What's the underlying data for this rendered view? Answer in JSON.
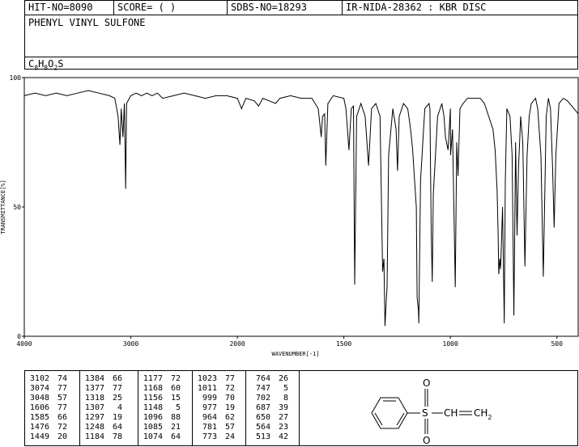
{
  "header": {
    "hit_no": "HIT-NO=8090",
    "score": "SCORE=  (   )",
    "sdbs_no": "SDBS-NO=18293",
    "source": "IR-NIDA-28362 : KBR DISC",
    "compound_name": "PHENYL VINYL SULFONE",
    "formula": {
      "c": "C",
      "c_n": "8",
      "h": "H",
      "h_n": "8",
      "o": "O",
      "o_n": "2",
      "s": "S"
    }
  },
  "chart_data": {
    "type": "line",
    "xlabel": "WAVENUMBER[-1]",
    "ylabel": "TRANSMITTANCE[%]",
    "xlim": [
      4000,
      400
    ],
    "ylim": [
      0,
      100
    ],
    "x_reversed": true,
    "xticks": [
      "4000",
      "3000",
      "2000",
      "1500",
      "1000",
      "500"
    ],
    "yticks": [
      "100",
      "50",
      "0"
    ],
    "grid": false,
    "series": [
      {
        "color": "#000000",
        "points": [
          [
            4000,
            93
          ],
          [
            3900,
            94
          ],
          [
            3800,
            93
          ],
          [
            3700,
            94
          ],
          [
            3600,
            93
          ],
          [
            3500,
            94
          ],
          [
            3400,
            95
          ],
          [
            3300,
            94
          ],
          [
            3200,
            93
          ],
          [
            3150,
            92
          ],
          [
            3120,
            85
          ],
          [
            3102,
            74
          ],
          [
            3090,
            88
          ],
          [
            3074,
            77
          ],
          [
            3060,
            90
          ],
          [
            3048,
            57
          ],
          [
            3040,
            90
          ],
          [
            3000,
            93
          ],
          [
            2950,
            94
          ],
          [
            2900,
            93
          ],
          [
            2850,
            94
          ],
          [
            2800,
            93
          ],
          [
            2750,
            94
          ],
          [
            2700,
            92
          ],
          [
            2600,
            93
          ],
          [
            2500,
            94
          ],
          [
            2400,
            93
          ],
          [
            2300,
            92
          ],
          [
            2200,
            93
          ],
          [
            2100,
            93
          ],
          [
            2000,
            92
          ],
          [
            1980,
            88
          ],
          [
            1960,
            92
          ],
          [
            1920,
            91
          ],
          [
            1900,
            89
          ],
          [
            1880,
            92
          ],
          [
            1850,
            91
          ],
          [
            1820,
            90
          ],
          [
            1800,
            92
          ],
          [
            1750,
            93
          ],
          [
            1700,
            92
          ],
          [
            1650,
            92
          ],
          [
            1620,
            88
          ],
          [
            1606,
            77
          ],
          [
            1600,
            85
          ],
          [
            1590,
            86
          ],
          [
            1585,
            66
          ],
          [
            1575,
            90
          ],
          [
            1550,
            93
          ],
          [
            1500,
            92
          ],
          [
            1490,
            88
          ],
          [
            1476,
            72
          ],
          [
            1465,
            88
          ],
          [
            1455,
            89
          ],
          [
            1449,
            20
          ],
          [
            1440,
            85
          ],
          [
            1420,
            90
          ],
          [
            1400,
            85
          ],
          [
            1384,
            66
          ],
          [
            1377,
            77
          ],
          [
            1370,
            88
          ],
          [
            1350,
            90
          ],
          [
            1330,
            85
          ],
          [
            1318,
            25
          ],
          [
            1312,
            30
          ],
          [
            1307,
            4
          ],
          [
            1300,
            15
          ],
          [
            1297,
            19
          ],
          [
            1290,
            70
          ],
          [
            1270,
            88
          ],
          [
            1255,
            80
          ],
          [
            1248,
            64
          ],
          [
            1240,
            85
          ],
          [
            1220,
            90
          ],
          [
            1200,
            88
          ],
          [
            1190,
            82
          ],
          [
            1184,
            78
          ],
          [
            1177,
            72
          ],
          [
            1170,
            63
          ],
          [
            1168,
            60
          ],
          [
            1160,
            50
          ],
          [
            1156,
            15
          ],
          [
            1150,
            10
          ],
          [
            1148,
            5
          ],
          [
            1140,
            60
          ],
          [
            1120,
            88
          ],
          [
            1100,
            90
          ],
          [
            1096,
            88
          ],
          [
            1090,
            40
          ],
          [
            1085,
            21
          ],
          [
            1080,
            55
          ],
          [
            1074,
            64
          ],
          [
            1060,
            85
          ],
          [
            1040,
            90
          ],
          [
            1030,
            85
          ],
          [
            1023,
            77
          ],
          [
            1011,
            72
          ],
          [
            1000,
            88
          ],
          [
            999,
            70
          ],
          [
            990,
            80
          ],
          [
            977,
            19
          ],
          [
            970,
            75
          ],
          [
            964,
            62
          ],
          [
            955,
            88
          ],
          [
            940,
            90
          ],
          [
            920,
            92
          ],
          [
            900,
            92
          ],
          [
            880,
            92
          ],
          [
            860,
            92
          ],
          [
            840,
            90
          ],
          [
            820,
            85
          ],
          [
            800,
            80
          ],
          [
            790,
            72
          ],
          [
            781,
            57
          ],
          [
            776,
            40
          ],
          [
            773,
            24
          ],
          [
            768,
            30
          ],
          [
            764,
            26
          ],
          [
            755,
            50
          ],
          [
            747,
            5
          ],
          [
            742,
            60
          ],
          [
            735,
            88
          ],
          [
            720,
            85
          ],
          [
            710,
            70
          ],
          [
            702,
            8
          ],
          [
            698,
            40
          ],
          [
            694,
            75
          ],
          [
            687,
            39
          ],
          [
            680,
            65
          ],
          [
            670,
            85
          ],
          [
            660,
            75
          ],
          [
            650,
            27
          ],
          [
            640,
            70
          ],
          [
            630,
            85
          ],
          [
            620,
            90
          ],
          [
            600,
            92
          ],
          [
            590,
            88
          ],
          [
            575,
            70
          ],
          [
            564,
            23
          ],
          [
            560,
            40
          ],
          [
            550,
            85
          ],
          [
            540,
            92
          ],
          [
            530,
            88
          ],
          [
            520,
            65
          ],
          [
            513,
            42
          ],
          [
            505,
            70
          ],
          [
            490,
            90
          ],
          [
            470,
            92
          ],
          [
            450,
            91
          ],
          [
            430,
            89
          ],
          [
            410,
            87
          ],
          [
            400,
            86
          ]
        ]
      }
    ]
  },
  "peak_table": {
    "columns": [
      [
        [
          "3102",
          "74"
        ],
        [
          "3074",
          "77"
        ],
        [
          "3048",
          "57"
        ],
        [
          "1606",
          "77"
        ],
        [
          "1585",
          "66"
        ],
        [
          "1476",
          "72"
        ],
        [
          "1449",
          "20"
        ]
      ],
      [
        [
          "1384",
          "66"
        ],
        [
          "1377",
          "77"
        ],
        [
          "1318",
          "25"
        ],
        [
          "1307",
          "4"
        ],
        [
          "1297",
          "19"
        ],
        [
          "1248",
          "64"
        ],
        [
          "1184",
          "78"
        ]
      ],
      [
        [
          "1177",
          "72"
        ],
        [
          "1168",
          "60"
        ],
        [
          "1156",
          "15"
        ],
        [
          "1148",
          "5"
        ],
        [
          "1096",
          "88"
        ],
        [
          "1085",
          "21"
        ],
        [
          "1074",
          "64"
        ]
      ],
      [
        [
          "1023",
          "77"
        ],
        [
          "1011",
          "72"
        ],
        [
          "999",
          "70"
        ],
        [
          "977",
          "19"
        ],
        [
          "964",
          "62"
        ],
        [
          "781",
          "57"
        ],
        [
          "773",
          "24"
        ]
      ],
      [
        [
          "764",
          "26"
        ],
        [
          "747",
          "5"
        ],
        [
          "702",
          "8"
        ],
        [
          "687",
          "39"
        ],
        [
          "650",
          "27"
        ],
        [
          "564",
          "23"
        ],
        [
          "513",
          "42"
        ]
      ]
    ]
  },
  "structure": {
    "atom_o_top": "O",
    "atom_s": "S",
    "atom_o_bottom": "O",
    "vinyl_ch": "CH",
    "vinyl_ch2": "CH",
    "vinyl_ch2_sub": "2"
  }
}
